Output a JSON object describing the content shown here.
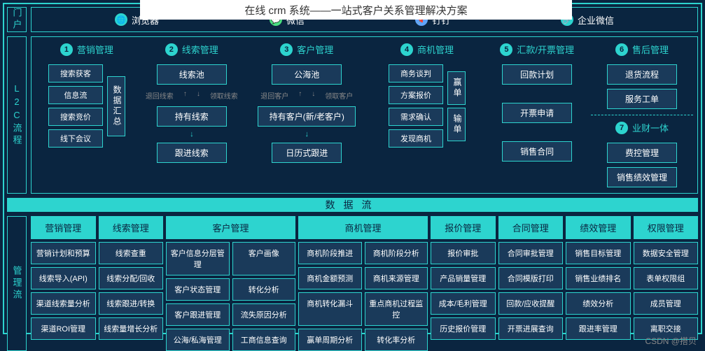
{
  "title": "在线 crm 系统——一站式客户关系管理解决方案",
  "watermark": "CSDN @搭贝",
  "portal": {
    "label": "门户",
    "items": [
      {
        "icon": "🌐",
        "label": "浏览器",
        "color": "#2dd4cf"
      },
      {
        "icon": "💬",
        "label": "微信",
        "color": "#4ade80"
      },
      {
        "icon": "📌",
        "label": "钉钉",
        "color": "#60a5fa"
      },
      {
        "icon": "🔗",
        "label": "企业微信",
        "color": "#2dd4cf"
      }
    ]
  },
  "l2c": {
    "label": "L2C流程",
    "cols": [
      {
        "num": "1",
        "title": "营销管理",
        "nodes": [
          "搜索获客",
          "信息流",
          "搜索竞价",
          "线下会议"
        ],
        "side": "数据汇总"
      },
      {
        "num": "2",
        "title": "线索管理",
        "nodes": [
          "线索池",
          "持有线索",
          "跟进线索"
        ],
        "flow": [
          "退回线索",
          "领取线索"
        ]
      },
      {
        "num": "3",
        "title": "客户管理",
        "nodes": [
          "公海池",
          "持有客户(新/老客户)",
          "日历式跟进"
        ],
        "flow": [
          "退回客户",
          "领取客户"
        ]
      },
      {
        "num": "4",
        "title": "商机管理",
        "nodes": [
          "商务谈判",
          "方案报价",
          "需求确认",
          "发现商机"
        ],
        "side1": "赢单",
        "side2": "输单"
      },
      {
        "num": "5",
        "title": "汇款/开票管理",
        "nodes": [
          "回款计划",
          "开票申请",
          "销售合同"
        ]
      },
      {
        "num": "6",
        "title": "售后管理",
        "nodes": [
          "退货流程",
          "服务工单"
        ]
      },
      {
        "num": "7",
        "title": "业财一体",
        "nodes": [
          "费控管理",
          "销售绩效管理"
        ]
      }
    ]
  },
  "dataflow": "数据流",
  "mgmt": {
    "label": "管理流",
    "cols": [
      {
        "head": "营销管理",
        "cells": [
          "营销计划和预算",
          "线索导入(API)",
          "渠道线索量分析",
          "渠道ROI管理"
        ]
      },
      {
        "head": "线索管理",
        "cells": [
          "线索查重",
          "线索分配/回收",
          "线索跟进/转换",
          "线索量增长分析"
        ]
      },
      {
        "head": "客户管理",
        "wide": true,
        "pairs": [
          [
            "客户信息分层管理",
            "客户画像"
          ],
          [
            "客户状态管理",
            "转化分析"
          ],
          [
            "客户跟进管理",
            "流失原因分析"
          ],
          [
            "公海/私海管理",
            "工商信息查询"
          ]
        ]
      },
      {
        "head": "商机管理",
        "wide": true,
        "pairs": [
          [
            "商机阶段推进",
            "商机阶段分析"
          ],
          [
            "商机金额预测",
            "商机来源管理"
          ],
          [
            "商机转化漏斗",
            "重点商机过程监控"
          ],
          [
            "赢单周期分析",
            "转化率分析"
          ]
        ]
      },
      {
        "head": "报价管理",
        "cells": [
          "报价审批",
          "产品销量管理",
          "成本/毛利管理",
          "历史报价管理"
        ]
      },
      {
        "head": "合同管理",
        "cells": [
          "合同审批管理",
          "合同模版打印",
          "回款/应收提醒",
          "开票进展查询"
        ]
      },
      {
        "head": "绩效管理",
        "cells": [
          "销售目标管理",
          "销售业绩排名",
          "绩效分析",
          "跟进率管理"
        ]
      },
      {
        "head": "权限管理",
        "cells": [
          "数据安全管理",
          "表单权限组",
          "成员管理",
          "离职交接"
        ]
      }
    ]
  }
}
